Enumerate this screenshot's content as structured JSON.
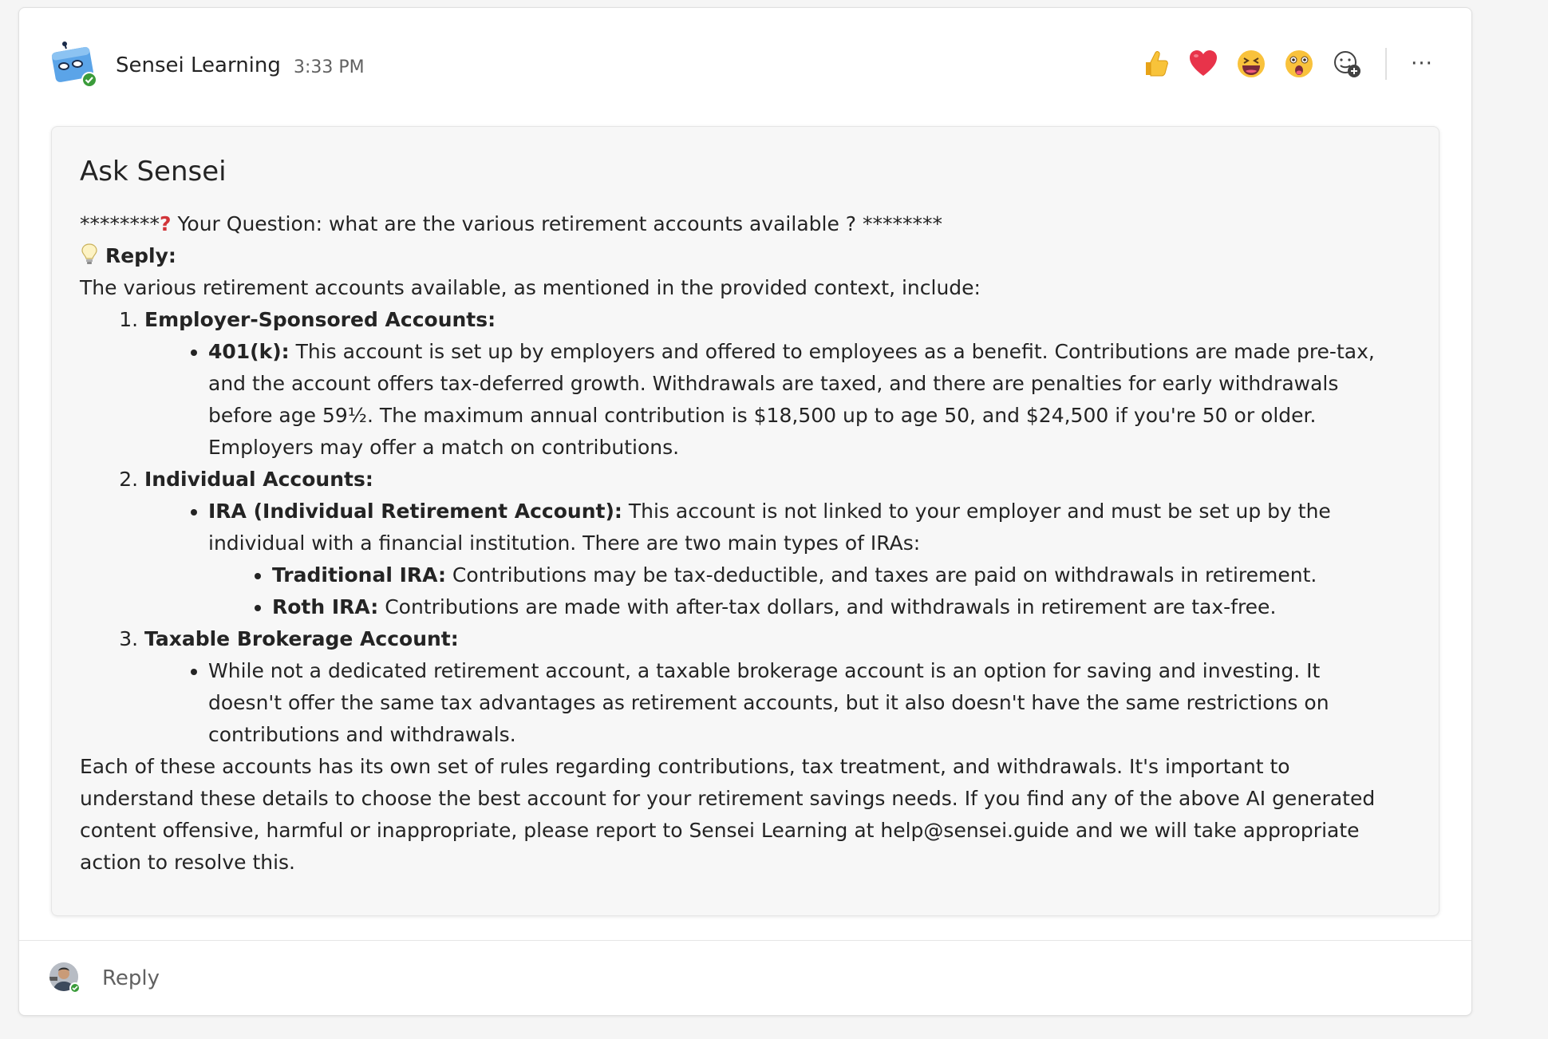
{
  "header": {
    "sender": "Sensei Learning",
    "timestamp": "3:33 PM",
    "reactions": [
      {
        "icon": "thumbs-up-icon"
      },
      {
        "icon": "heart-icon"
      },
      {
        "icon": "laughing-face-icon"
      },
      {
        "icon": "surprised-face-icon"
      },
      {
        "icon": "add-reaction-icon"
      }
    ],
    "more_label": "···"
  },
  "card": {
    "title": "Ask Sensei",
    "question_prefix": "********",
    "question_text": " Your Question: what are the various retirement accounts available ? ********",
    "reply_label": "Reply:",
    "intro": "The various retirement accounts available, as mentioned in the provided context, include:",
    "sections": [
      {
        "heading": "Employer-Sponsored Accounts:",
        "bullets": [
          {
            "term": "401(k):",
            "lines": [
              " This account is set up by employers and offered to employees as a benefit. Contributions are made pre-tax,",
              "and the account offers tax-deferred growth. Withdrawals are taxed, and there are penalties for early withdrawals",
              "before age 59½. The maximum annual contribution is $18,500 up to age 50, and $24,500 if you're 50 or older.",
              "Employers may offer a match on contributions."
            ]
          }
        ]
      },
      {
        "heading": "Individual Accounts:",
        "bullets": [
          {
            "term": "IRA (Individual Retirement Account):",
            "lines": [
              " This account is not linked to your employer and must be set up by the",
              "individual with a financial institution. There are two main types of IRAs:"
            ],
            "sub": [
              {
                "term": "Traditional IRA:",
                "text": " Contributions may be tax-deductible, and taxes are paid on withdrawals in retirement."
              },
              {
                "term": "Roth IRA:",
                "text": " Contributions are made with after-tax dollars, and withdrawals in retirement are tax-free."
              }
            ]
          }
        ]
      },
      {
        "heading": "Taxable Brokerage Account:",
        "bullets": [
          {
            "term": "",
            "lines": [
              "While not a dedicated retirement account, a taxable brokerage account is an option for saving and investing. It",
              "doesn't offer the same tax advantages as retirement accounts, but it also doesn't have the same restrictions on",
              "contributions and withdrawals."
            ]
          }
        ]
      }
    ],
    "closing": [
      "Each of these accounts has its own set of rules regarding contributions, tax treatment, and withdrawals. It's important to",
      "understand these details to choose the best account for your retirement savings needs. If you find any of the above AI generated",
      "content offensive, harmful or inappropriate, please report to Sensei Learning at help@sensei.guide and we will take appropriate",
      "action to resolve this."
    ]
  },
  "footer": {
    "reply_label": "Reply"
  },
  "colors": {
    "bot_avatar": "#5ba4e8",
    "presence": "#3a9b3a",
    "question_mark": "#d13438"
  }
}
